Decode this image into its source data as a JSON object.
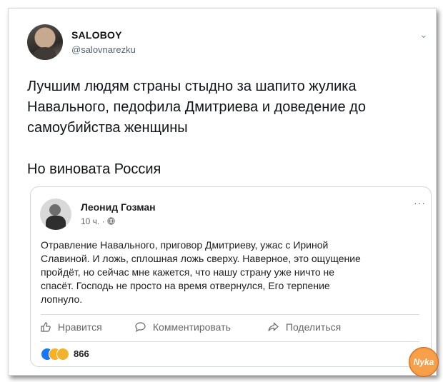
{
  "tweet": {
    "author_name": "SALOBOY",
    "author_handle": "@salovnarezku",
    "menu_icon": "chevron-down-icon",
    "text_lines": [
      "Лучшим людям страны стыдно за шапито жулика",
      "Навального, педофила Дмитриева и доведение до",
      "самоубийства женщины",
      "Но виновата Россия"
    ]
  },
  "fb_post": {
    "author_name": "Леонид Гозман",
    "meta": "10 ч. ·",
    "audience_icon": "globe-icon",
    "menu_icon": "more-dots-icon",
    "text_lines": [
      "Отравление Навального, приговор Дмитриеву, ужас с Ириной",
      "Славиной. И ложь, сплошная ложь сверху. Наверное, это ощущение",
      "пройдёт, но сейчас мне кажется, что нашу страну уже ничто не",
      "спасёт. Господь не просто на время отвернулся, Его терпение",
      "лопнуло."
    ],
    "actions": {
      "like": "Нравится",
      "comment": "Комментировать",
      "share": "Поделиться"
    },
    "reactions_count": "866",
    "reaction_icons": [
      "like-reaction-icon",
      "sad-reaction-icon",
      "care-reaction-icon"
    ]
  },
  "watermark": {
    "text": "Nyka"
  }
}
